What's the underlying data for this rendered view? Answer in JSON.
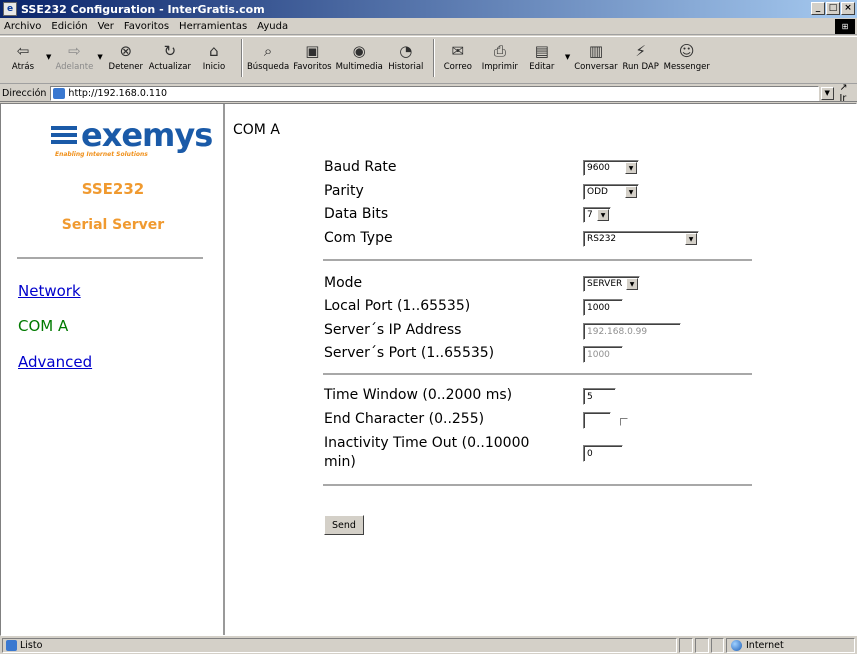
{
  "window": {
    "title": "SSE232 Configuration - InterGratis.com"
  },
  "menu": [
    "Archivo",
    "Edición",
    "Ver",
    "Favoritos",
    "Herramientas",
    "Ayuda"
  ],
  "toolbar": {
    "back": "Atrás",
    "forward": "Adelante",
    "stop": "Detener",
    "refresh": "Actualizar",
    "home": "Inicio",
    "search": "Búsqueda",
    "favorites": "Favoritos",
    "media": "Multimedia",
    "history": "Historial",
    "mail": "Correo",
    "print": "Imprimir",
    "edit": "Editar",
    "discuss": "Conversar",
    "rundap": "Run DAP",
    "messenger": "Messenger"
  },
  "address": {
    "label": "Dirección",
    "url": "http://192.168.0.110",
    "go": "Ir"
  },
  "sidebar": {
    "logo_text": "exemys",
    "logo_tagline": "Enabling Internet Solutions",
    "product_name": "SSE232",
    "product_desc": "Serial Server",
    "nav": [
      {
        "label": "Network",
        "active": false
      },
      {
        "label": "COM A",
        "active": true
      },
      {
        "label": "Advanced",
        "active": false
      }
    ]
  },
  "form": {
    "title": "COM A",
    "baud_rate": {
      "label": "Baud Rate",
      "value": "9600"
    },
    "parity": {
      "label": "Parity",
      "value": "ODD"
    },
    "data_bits": {
      "label": "Data Bits",
      "value": "7"
    },
    "com_type": {
      "label": "Com Type",
      "value": "RS232"
    },
    "mode": {
      "label": "Mode",
      "value": "SERVER"
    },
    "local_port": {
      "label": "Local Port (1..65535)",
      "value": "1000"
    },
    "server_ip": {
      "label": "Server´s IP Address",
      "value": "192.168.0.99"
    },
    "server_port": {
      "label": "Server´s Port (1..65535)",
      "value": "1000"
    },
    "time_window": {
      "label": "Time Window (0..2000 ms)",
      "value": "5"
    },
    "end_char": {
      "label": "End Character (0..255)",
      "value": ""
    },
    "inactivity_line1": "Inactivity Time Out (0..10000",
    "inactivity_line2": "min)",
    "inactivity_value": "0",
    "send_label": "Send"
  },
  "status": {
    "text": "Listo",
    "zone": "Internet"
  },
  "colors": {
    "accent": "#f09a30",
    "link": "#0000cc",
    "active_link": "#007a00",
    "logo": "#1a5aa8"
  }
}
